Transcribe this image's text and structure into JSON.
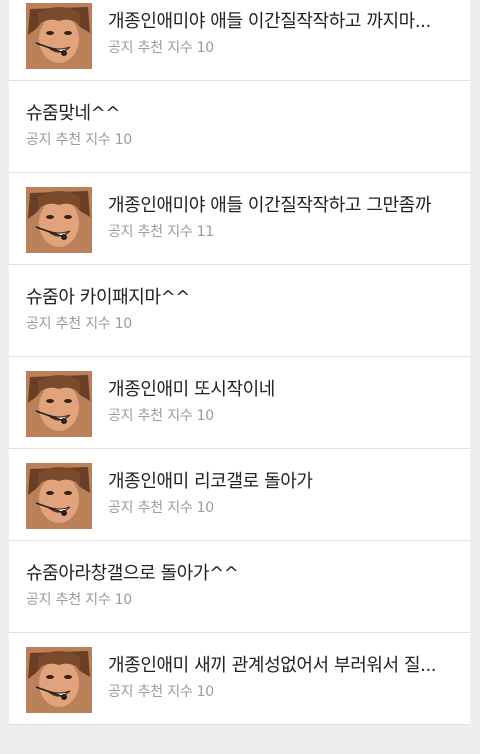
{
  "meta_label": "공지 추천 지수",
  "posts": [
    {
      "title": "개종인애미야 애들 이간질작작하고 까지마...",
      "score": "10",
      "has_thumb": true
    },
    {
      "title": "슈줌맞네^^",
      "score": "10",
      "has_thumb": false
    },
    {
      "title": "개종인애미야 애들 이간질작작하고 그만좀까",
      "score": "11",
      "has_thumb": true
    },
    {
      "title": "슈줌아 카이패지마^^",
      "score": "10",
      "has_thumb": false
    },
    {
      "title": "개종인애미 또시작이네",
      "score": "10",
      "has_thumb": true
    },
    {
      "title": "개종인애미 리코갤로 돌아가",
      "score": "10",
      "has_thumb": true
    },
    {
      "title": "슈줌아라창갤으로 돌아가^^",
      "score": "10",
      "has_thumb": false
    },
    {
      "title": "개종인애미 새끼 관계성없어서 부러워서 질...",
      "score": "10",
      "has_thumb": true
    }
  ],
  "colors": {
    "title": "#222222",
    "meta": "#9b9b9b",
    "divider": "#e2e2e2",
    "background": "#eeeeee"
  }
}
